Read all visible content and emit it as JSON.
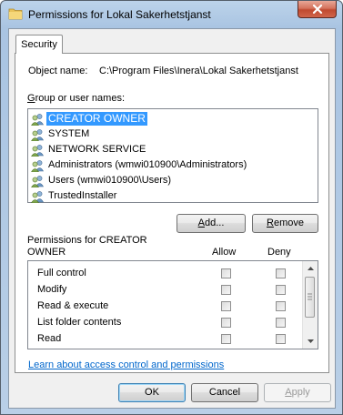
{
  "window": {
    "title": "Permissions for Lokal Sakerhetstjanst"
  },
  "tab": {
    "label": "Security"
  },
  "object": {
    "label": "Object name:",
    "path": "C:\\Program Files\\Inera\\Lokal Sakerhetstjanst"
  },
  "group_label": "Group or user names:",
  "users": [
    {
      "name": "CREATOR OWNER",
      "selected": true
    },
    {
      "name": "SYSTEM"
    },
    {
      "name": "NETWORK SERVICE"
    },
    {
      "name": "Administrators (wmwi010900\\Administrators)"
    },
    {
      "name": "Users (wmwi010900\\Users)"
    },
    {
      "name": "TrustedInstaller"
    }
  ],
  "buttons": {
    "add": "Add...",
    "remove": "Remove",
    "ok": "OK",
    "cancel": "Cancel",
    "apply": "Apply"
  },
  "permissions_header": {
    "line1": "Permissions for CREATOR",
    "line2": "OWNER",
    "allow": "Allow",
    "deny": "Deny"
  },
  "permissions": [
    {
      "name": "Full control"
    },
    {
      "name": "Modify"
    },
    {
      "name": "Read & execute"
    },
    {
      "name": "List folder contents"
    },
    {
      "name": "Read"
    }
  ],
  "link": "Learn about access control and permissions",
  "colors": {
    "selection": "#3399ff",
    "link": "#0066cc",
    "close_button": "#c04a30"
  }
}
